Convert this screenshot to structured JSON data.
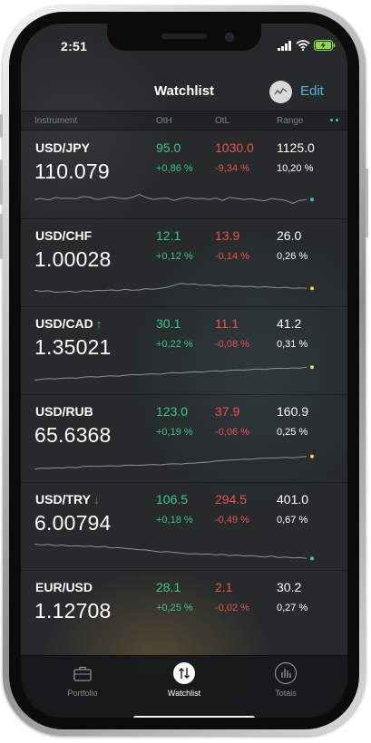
{
  "status_bar": {
    "time": "2:51"
  },
  "nav": {
    "title": "Watchlist",
    "edit_label": "Edit"
  },
  "columns": {
    "instrument": "Instrument",
    "oth": "OtH",
    "otl": "OtL",
    "range": "Range"
  },
  "colors": {
    "green": "#3cc68a",
    "red": "#ef4f4f",
    "accent": "#4fb4e6",
    "cyan_dot": "#33c3d8",
    "yellow_dot": "#e9d44a"
  },
  "rows": [
    {
      "symbol": "USD/JPY",
      "price": "110.079",
      "arrow": "",
      "oth": "95.0",
      "oth_pct": "+0,86 %",
      "otl": "1030.0",
      "otl_pct": "-9,34 %",
      "range": "1125.0",
      "range_pct": "10,20 %",
      "dot_color": "#33c3d8",
      "spark": [
        0.55,
        0.5,
        0.58,
        0.45,
        0.5,
        0.48,
        0.52,
        0.4,
        0.45,
        0.55,
        0.5,
        0.42,
        0.48,
        0.52,
        0.45,
        0.3,
        0.45,
        0.55,
        0.5,
        0.48,
        0.6,
        0.5,
        0.45,
        0.52,
        0.5,
        0.55,
        0.48,
        0.6,
        0.45,
        0.5,
        0.55,
        0.52,
        0.58,
        0.62,
        0.5,
        0.55,
        0.6,
        0.75,
        0.6,
        0.55
      ]
    },
    {
      "symbol": "USD/CHF",
      "price": "1.00028",
      "arrow": "",
      "oth": "12.1",
      "oth_pct": "+0,12 %",
      "otl": "13.9",
      "otl_pct": "-0,14 %",
      "range": "26.0",
      "range_pct": "0,26 %",
      "dot_color": "#e9d44a",
      "spark": [
        0.7,
        0.75,
        0.72,
        0.8,
        0.78,
        0.75,
        0.8,
        0.72,
        0.75,
        0.7,
        0.72,
        0.68,
        0.72,
        0.65,
        0.7,
        0.68,
        0.62,
        0.65,
        0.6,
        0.55,
        0.45,
        0.35,
        0.4,
        0.38,
        0.45,
        0.42,
        0.48,
        0.45,
        0.5,
        0.48,
        0.52,
        0.5,
        0.55,
        0.52,
        0.55,
        0.58,
        0.55,
        0.6,
        0.58,
        0.6
      ]
    },
    {
      "symbol": "USD/CAD",
      "price": "1.35021",
      "arrow": "↑",
      "oth": "30.1",
      "oth_pct": "+0,22 %",
      "otl": "11.1",
      "otl_pct": "-0,08 %",
      "range": "41.2",
      "range_pct": "0,31 %",
      "dot_color": "#e9d44a",
      "spark": [
        0.8,
        0.75,
        0.72,
        0.74,
        0.7,
        0.68,
        0.7,
        0.65,
        0.62,
        0.64,
        0.6,
        0.58,
        0.6,
        0.55,
        0.52,
        0.54,
        0.5,
        0.48,
        0.5,
        0.45,
        0.42,
        0.44,
        0.4,
        0.38,
        0.4,
        0.35,
        0.33,
        0.35,
        0.3,
        0.28,
        0.3,
        0.26,
        0.24,
        0.26,
        0.22,
        0.2,
        0.22,
        0.18,
        0.2,
        0.15
      ]
    },
    {
      "symbol": "USD/RUB",
      "price": "65.6368",
      "arrow": "",
      "oth": "123.0",
      "oth_pct": "+0,19 %",
      "otl": "37.9",
      "otl_pct": "-0,06 %",
      "range": "160.9",
      "range_pct": "0,25 %",
      "dot_color": "#e9d44a",
      "spark": [
        0.85,
        0.8,
        0.82,
        0.78,
        0.8,
        0.75,
        0.78,
        0.72,
        0.7,
        0.72,
        0.7,
        0.68,
        0.7,
        0.66,
        0.65,
        0.66,
        0.64,
        0.62,
        0.64,
        0.6,
        0.58,
        0.6,
        0.56,
        0.55,
        0.52,
        0.5,
        0.45,
        0.42,
        0.4,
        0.38,
        0.35,
        0.36,
        0.32,
        0.3,
        0.3,
        0.28,
        0.26,
        0.28,
        0.25,
        0.22
      ]
    },
    {
      "symbol": "USD/TRY",
      "price": "6.00794",
      "arrow": "↓",
      "oth": "106.5",
      "oth_pct": "+0,18 %",
      "otl": "294.5",
      "otl_pct": "-0,49 %",
      "range": "401.0",
      "range_pct": "0,67 %",
      "dot_color": "#33c3d8",
      "spark": [
        0.2,
        0.25,
        0.22,
        0.28,
        0.25,
        0.3,
        0.28,
        0.32,
        0.3,
        0.35,
        0.32,
        0.4,
        0.38,
        0.42,
        0.45,
        0.48,
        0.5,
        0.55,
        0.6,
        0.58,
        0.62,
        0.65,
        0.7,
        0.68,
        0.72,
        0.7,
        0.75,
        0.72,
        0.78,
        0.75,
        0.8,
        0.78,
        0.82,
        0.85,
        0.8,
        0.88,
        0.85,
        0.9,
        0.88,
        0.92
      ]
    },
    {
      "symbol": "EUR/USD",
      "price": "1.12708",
      "arrow": "",
      "oth": "28.1",
      "oth_pct": "+0,25 %",
      "otl": "2.1",
      "otl_pct": "-0,02 %",
      "range": "30.2",
      "range_pct": "0,27 %",
      "dot_color": "",
      "spark": []
    }
  ],
  "tabs": [
    {
      "label": "Portfolio",
      "icon": "briefcase-icon"
    },
    {
      "label": "Watchlist",
      "icon": "arrows-swap-icon"
    },
    {
      "label": "Totals",
      "icon": "bar-chart-icon"
    }
  ]
}
